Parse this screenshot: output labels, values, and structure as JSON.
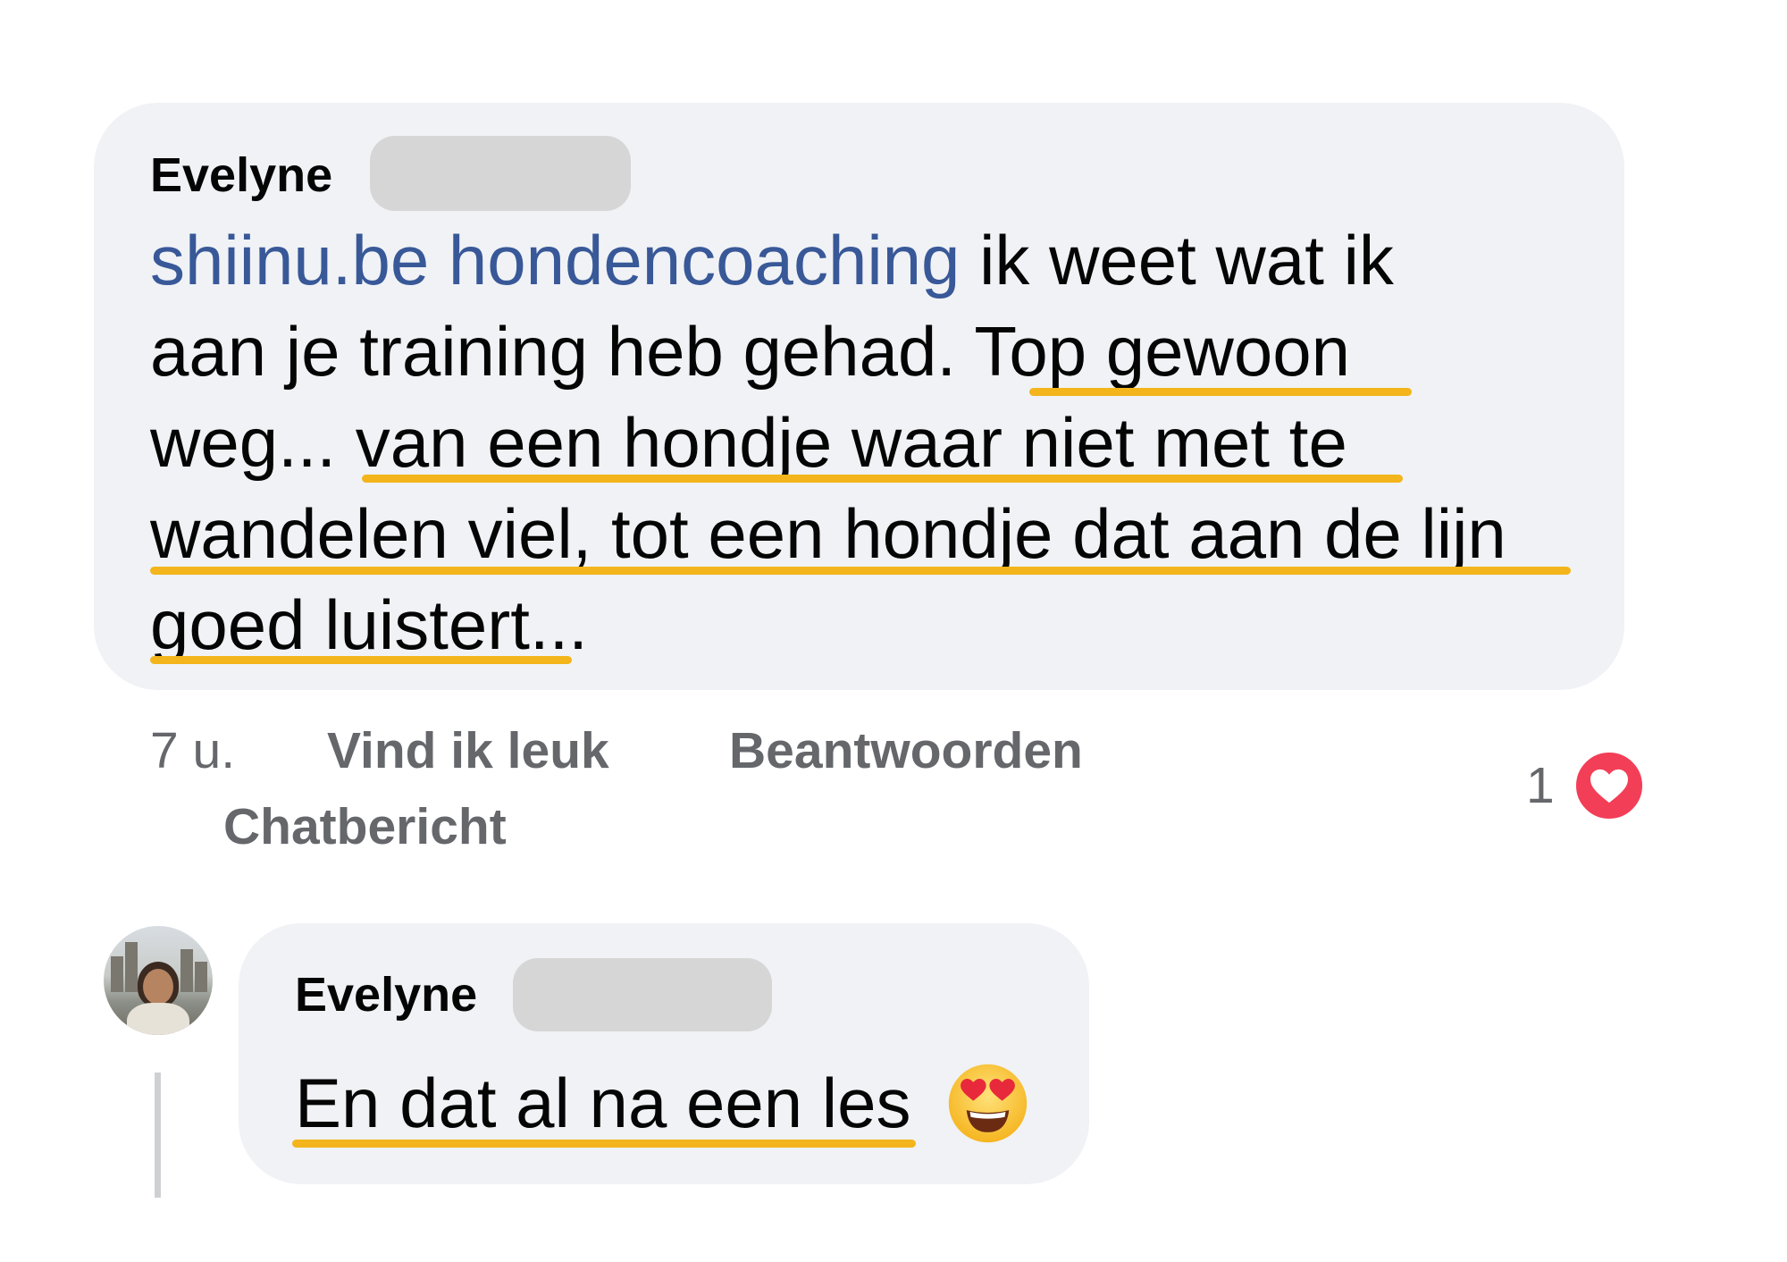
{
  "comment": {
    "author": "Evelyne",
    "link_text": "shiinu.be hondencoaching",
    "lines": [
      " ik weet wat ik",
      "aan je training heb gehad. Top gewoon",
      "weg... van een hondje waar niet met te",
      "wandelen viel, tot een hondje dat aan de lijn",
      "goed luistert..."
    ],
    "time": "7 u.",
    "like_label": "Vind ik leuk",
    "reply_label": "Beantwoorden",
    "chat_label": "Chatbericht",
    "reaction_count": "1",
    "reaction_icon": "heart-icon",
    "reaction_color": "#f33e58",
    "link_color": "#385898",
    "highlight_color": "#f3b51b"
  },
  "reply": {
    "author": "Evelyne",
    "text": "En dat al na een les",
    "emoji": "heart-eyes-emoji"
  }
}
